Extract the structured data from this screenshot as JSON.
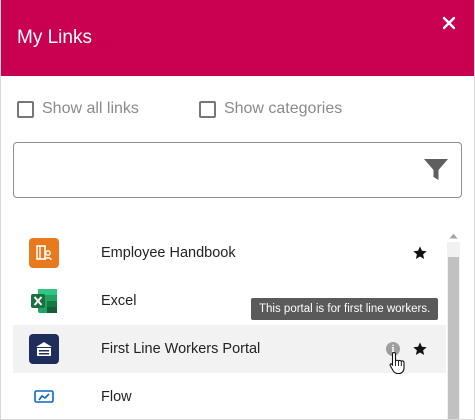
{
  "header": {
    "title": "My Links"
  },
  "options": {
    "show_all_links": "Show all links",
    "show_categories": "Show categories"
  },
  "search": {
    "value": "",
    "placeholder": ""
  },
  "links": [
    {
      "label": "Employee Handbook",
      "icon": "handbook-icon",
      "favorite": true
    },
    {
      "label": "Excel",
      "icon": "excel-icon",
      "favorite": false
    },
    {
      "label": "First Line Workers Portal",
      "icon": "portal-icon",
      "favorite": true
    },
    {
      "label": "Flow",
      "icon": "flow-icon",
      "favorite": false
    }
  ],
  "tooltip": {
    "text": "This portal is for first line workers."
  },
  "colors": {
    "header": "#c8004f",
    "handbook": "#e8791d",
    "excel": "#1d6f42",
    "portal": "#1f2d5c",
    "flow": "#0a66c2"
  }
}
